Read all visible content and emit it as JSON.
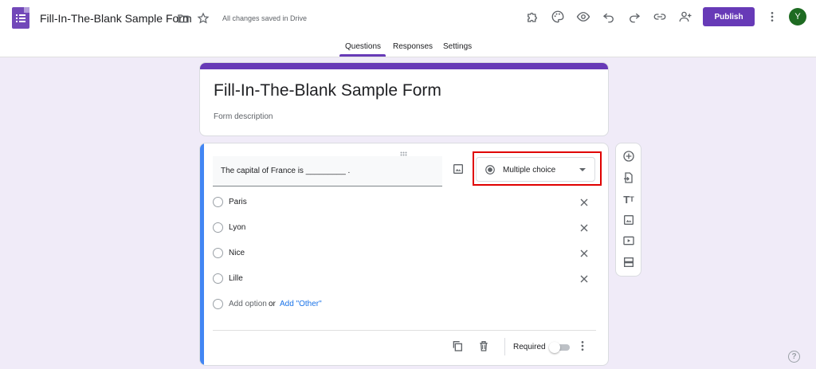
{
  "header": {
    "doc_title": "Fill-In-The-Blank Sample Form",
    "save_status": "All changes saved in Drive",
    "publish_label": "Publish",
    "avatar_letter": "Y",
    "icons": [
      "forms-logo-icon",
      "folder-icon",
      "star-icon",
      "addon-puzzle-icon",
      "palette-icon",
      "preview-eye-icon",
      "undo-icon",
      "redo-icon",
      "link-icon",
      "add-collaborator-icon",
      "more-vert-icon"
    ]
  },
  "tabs": [
    {
      "label": "Questions",
      "active": true
    },
    {
      "label": "Responses",
      "active": false
    },
    {
      "label": "Settings",
      "active": false
    }
  ],
  "form": {
    "title": "Fill-In-The-Blank Sample Form",
    "description_placeholder": "Form description"
  },
  "question": {
    "text": "The capital of France is _________ .",
    "type": "Multiple choice",
    "options": [
      "Paris",
      "Lyon",
      "Nice",
      "Lille"
    ],
    "add_option": "Add option",
    "or": "or",
    "add_other": "Add \"Other\"",
    "required_label": "Required",
    "required": false
  },
  "side_toolbar": [
    "add-question-icon",
    "import-questions-icon",
    "add-title-icon",
    "add-image-icon",
    "add-video-icon",
    "add-section-icon"
  ],
  "colors": {
    "brand": "#673ab7",
    "accent": "#4285f4",
    "background": "#f0ebf8",
    "highlight": "#e00000",
    "link": "#1a73e8"
  }
}
